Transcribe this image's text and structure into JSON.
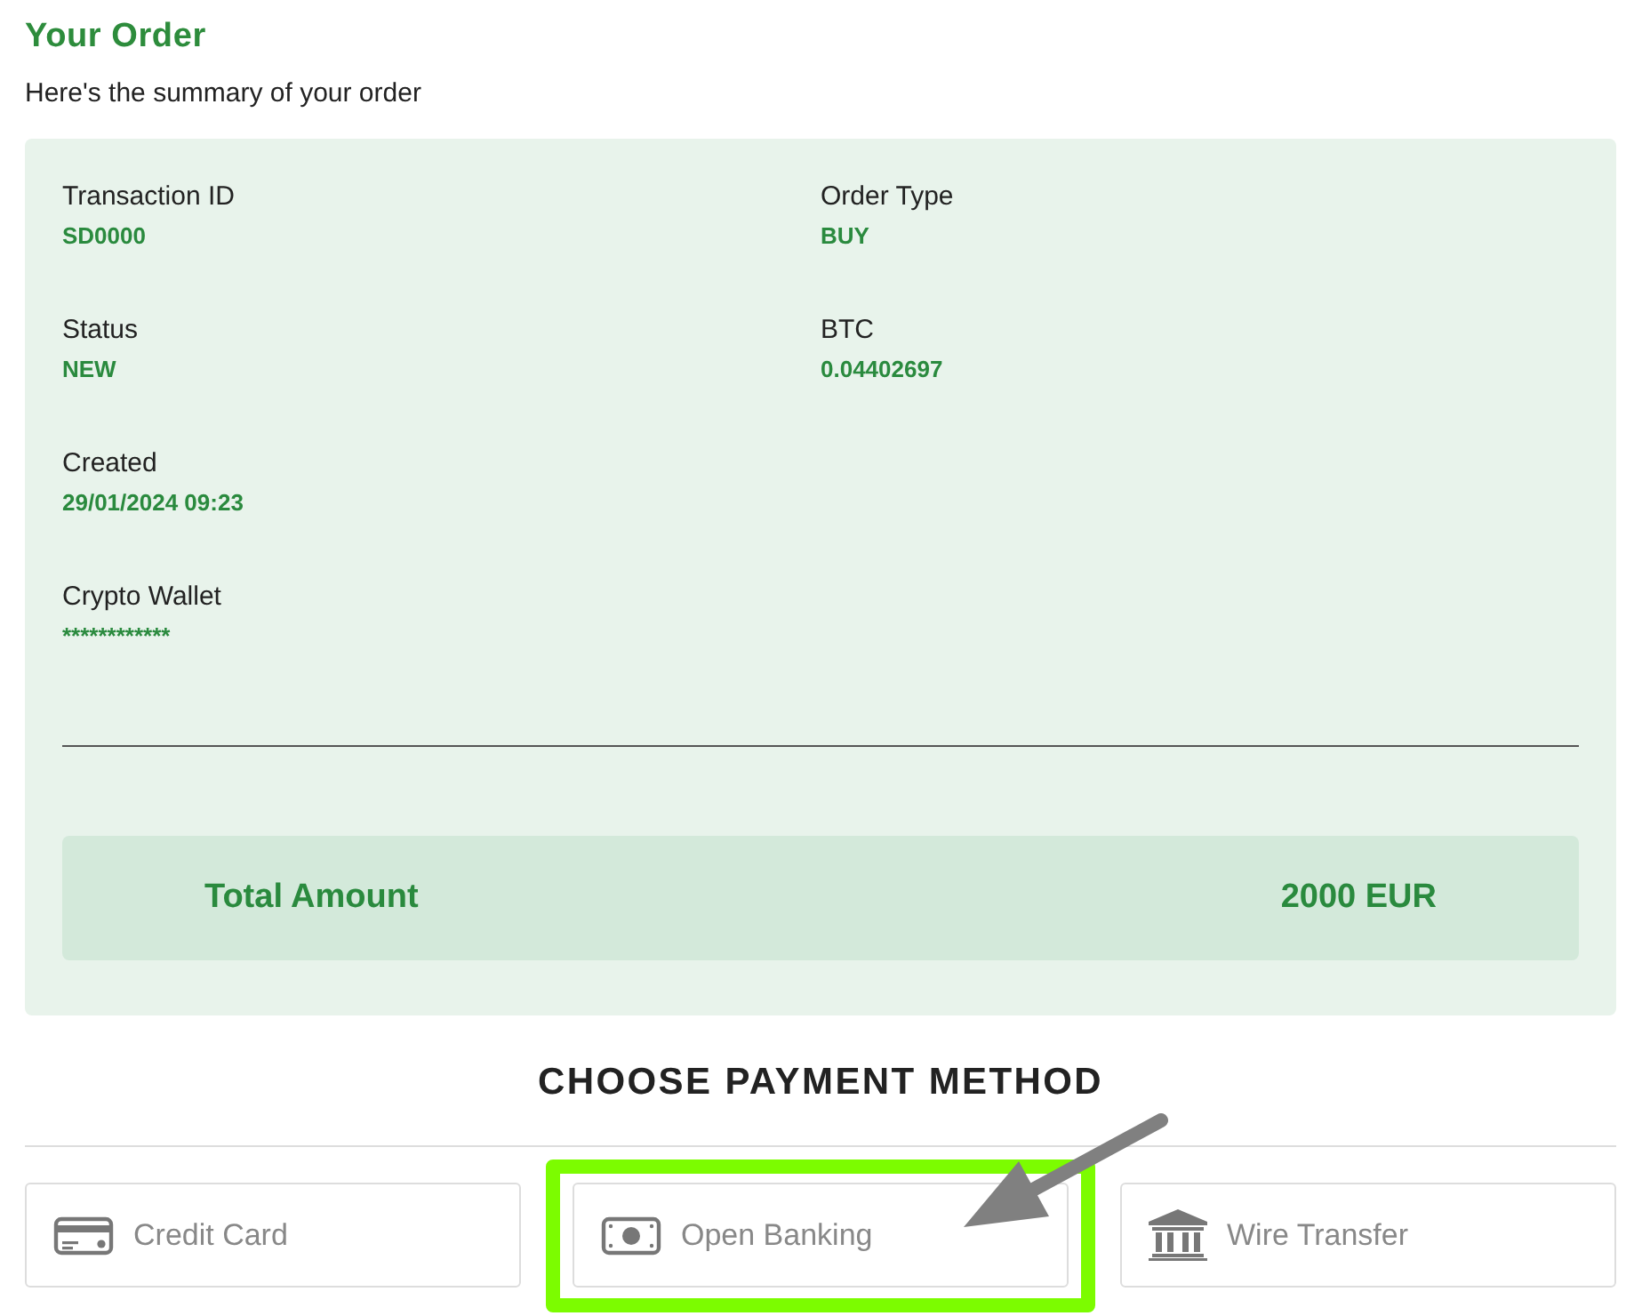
{
  "order": {
    "title": "Your Order",
    "subtitle": "Here's the summary of your order"
  },
  "detail_columns": [
    {
      "fields": [
        {
          "label": "Transaction ID",
          "value": "SD0000"
        },
        {
          "label": "Status",
          "value": "NEW"
        },
        {
          "label": "Created",
          "value": "29/01/2024 09:23"
        },
        {
          "label": "Crypto Wallet",
          "value": "************"
        }
      ]
    },
    {
      "fields": [
        {
          "label": "Order Type",
          "value": "BUY"
        },
        {
          "label": "BTC",
          "value": "0.04402697"
        }
      ]
    }
  ],
  "total": {
    "label": "Total Amount",
    "value": "2000 EUR"
  },
  "payment": {
    "heading": "CHOOSE PAYMENT METHOD",
    "methods": [
      {
        "kind": "card",
        "label": "Credit Card",
        "highlighted": false
      },
      {
        "kind": "cash",
        "label": "Open Banking",
        "highlighted": true
      },
      {
        "kind": "bank",
        "label": "Wire Transfer",
        "highlighted": false
      }
    ]
  }
}
